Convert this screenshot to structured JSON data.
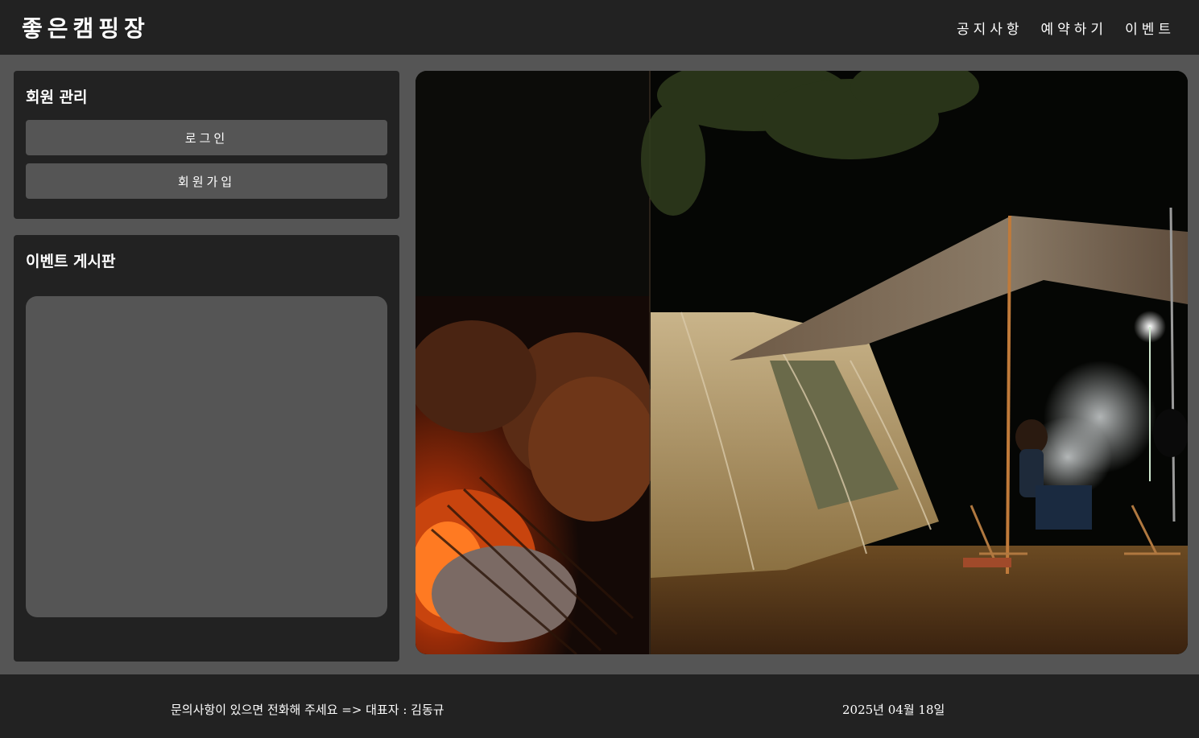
{
  "header": {
    "logo": "좋은캠핑장",
    "nav": [
      {
        "label": "공지사항"
      },
      {
        "label": "예약하기"
      },
      {
        "label": "이벤트"
      }
    ]
  },
  "member_panel": {
    "title": "회원 관리",
    "login_label": "로그인",
    "signup_label": "회원가입"
  },
  "event_panel": {
    "title": "이벤트 게시판"
  },
  "hero": {
    "image": "campfire-and-tent-at-night-photo"
  },
  "footer": {
    "contact": "문의사항이 있으면 전화해 주세요 => 대표자 : 김동규",
    "date": "2025년 04월 18일"
  },
  "colors": {
    "background": "#555555",
    "panel": "#222222",
    "button": "#555555",
    "text": "#ffffff"
  }
}
